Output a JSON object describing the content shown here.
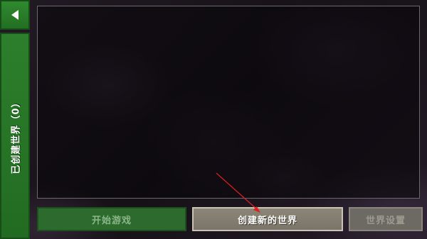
{
  "sidebar": {
    "back_icon": "left-triangle-icon",
    "worlds_tab_label": "已创建世界（0）"
  },
  "buttons": {
    "start_game": "开始游戏",
    "create_world": "创建新的世界",
    "world_settings": "世界设置"
  },
  "annotation": {
    "arrow_color": "#e02020"
  },
  "colors": {
    "sidebar_green": "#2c7f2c",
    "button_green": "#2d6a2d",
    "button_gray": "#8b8678"
  }
}
